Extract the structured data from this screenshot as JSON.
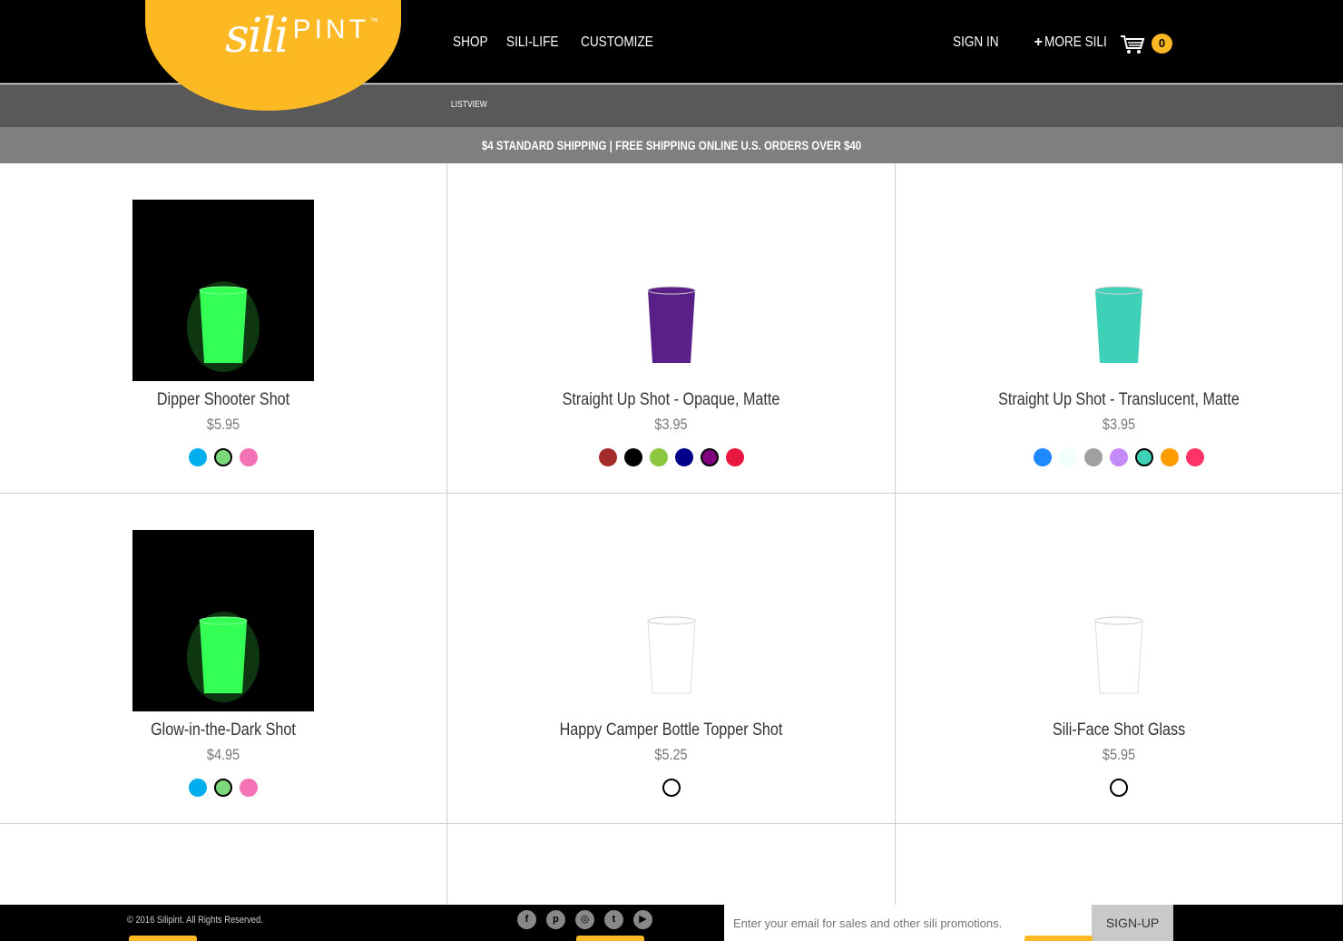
{
  "brand": {
    "sili": "sili",
    "pint": "PINT",
    "tm": "™"
  },
  "nav": {
    "shop": "SHOP",
    "sililife": "SILI-LIFE",
    "customize": "CUSTOMIZE",
    "signin": "SIGN IN",
    "more": "MORE SILI",
    "cart_count": "0"
  },
  "subnav": {
    "listview": "LISTVIEW"
  },
  "shipping_banner": "$4 STANDARD SHIPPING | FREE SHIPPING ONLINE U.S. ORDERS OVER $40",
  "products": [
    {
      "name": "Dipper Shooter Shot",
      "price": "$5.95",
      "dark": true,
      "swatches": [
        "#00aeef",
        "#7bd87b",
        "#f472b6"
      ],
      "selected": 1
    },
    {
      "name": "Straight Up Shot - Opaque, Matte",
      "price": "$3.95",
      "dark": false,
      "swatches": [
        "#a52a2a",
        "#000000",
        "#8dc63f",
        "#00008b",
        "#800080",
        "#e8173f"
      ],
      "selected": 4
    },
    {
      "name": "Straight Up Shot - Translucent, Matte",
      "price": "$3.95",
      "dark": false,
      "swatches": [
        "#1e88ff",
        "#f0fffb",
        "#a0a0a0",
        "#c58af9",
        "#3ed1b8",
        "#ff9d00",
        "#ff3366"
      ],
      "selected": 4
    },
    {
      "name": "Glow-in-the-Dark Shot",
      "price": "$4.95",
      "dark": true,
      "swatches": [
        "#00aeef",
        "#7bd87b",
        "#f472b6"
      ],
      "selected": 1
    },
    {
      "name": "Happy Camper Bottle Topper Shot",
      "price": "$5.25",
      "dark": false,
      "swatches": [
        "#ffffff"
      ],
      "selected": 0,
      "ring": true
    },
    {
      "name": "Sili-Face Shot Glass",
      "price": "$5.95",
      "dark": false,
      "swatches": [
        "#ffffff"
      ],
      "selected": 0,
      "ring": true
    }
  ],
  "footer": {
    "copyright": "© 2016 Silipint. All Rights Reserved.",
    "email_placeholder": "Enter your email for sales and other sili promotions.",
    "signup": "SIGN-UP"
  }
}
